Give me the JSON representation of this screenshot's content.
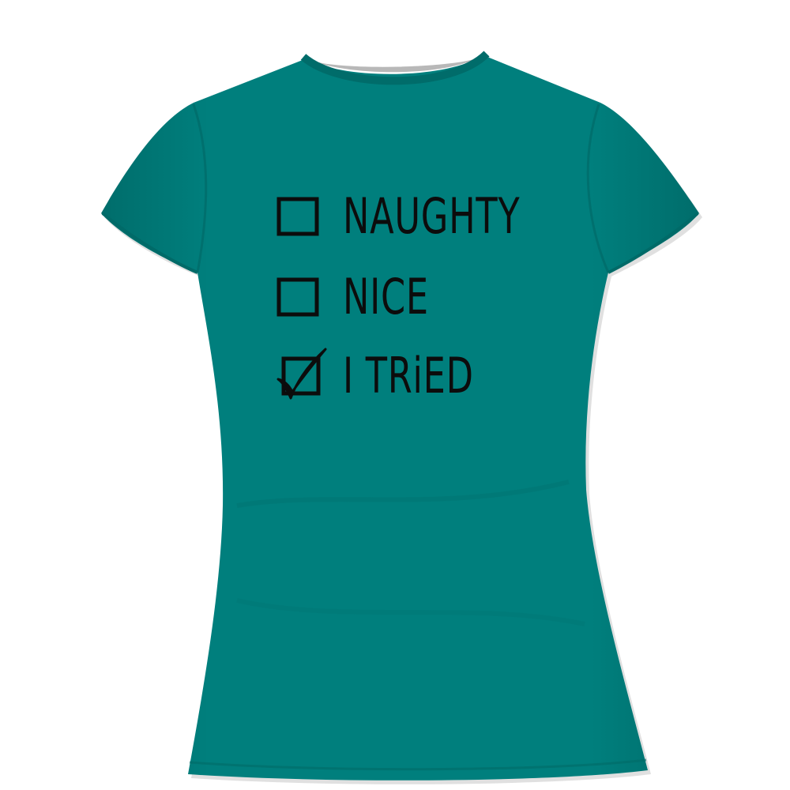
{
  "product": {
    "garment_color": "#007f7d",
    "garment_shadow_color": "#006765",
    "collar_inner_color": "#b8b8b8",
    "print_color": "#0c0c0c"
  },
  "print_checklist": [
    {
      "label": "NAUGHTY",
      "checked": false,
      "icon": "empty-checkbox-icon"
    },
    {
      "label": "NICE",
      "checked": false,
      "icon": "empty-checkbox-icon"
    },
    {
      "label": "I TRiED",
      "checked": true,
      "icon": "checked-checkbox-icon"
    }
  ]
}
